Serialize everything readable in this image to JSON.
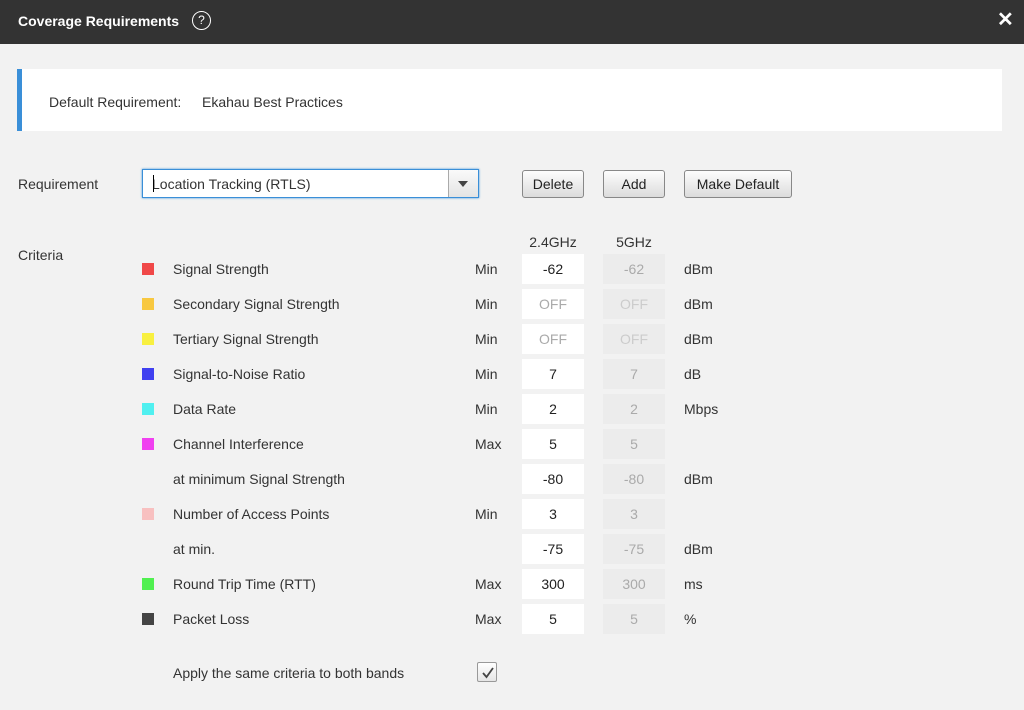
{
  "window": {
    "title": "Coverage Requirements",
    "help_icon": "question-circle-icon",
    "close_icon": "close-icon"
  },
  "banner": {
    "label": "Default Requirement:",
    "value": "Ekahau Best Practices",
    "accent": "#3a8fd8"
  },
  "requirement": {
    "label": "Requirement",
    "selected": "Location Tracking (RTLS)",
    "buttons": {
      "delete": "Delete",
      "add": "Add",
      "make_default": "Make Default"
    }
  },
  "criteria": {
    "label": "Criteria",
    "col_24": "2.4GHz",
    "col_5": "5GHz",
    "rows": [
      {
        "name": "Signal Strength",
        "minmax": "Min",
        "v24": "-62",
        "v5": "-62",
        "unit": "dBm",
        "color": "#f04848",
        "off": false
      },
      {
        "name": "Secondary Signal Strength",
        "minmax": "Min",
        "v24": "OFF",
        "v5": "OFF",
        "unit": "dBm",
        "color": "#f8c840",
        "off": true
      },
      {
        "name": "Tertiary Signal Strength",
        "minmax": "Min",
        "v24": "OFF",
        "v5": "OFF",
        "unit": "dBm",
        "color": "#f8f040",
        "off": true
      },
      {
        "name": "Signal-to-Noise Ratio",
        "minmax": "Min",
        "v24": "7",
        "v5": "7",
        "unit": "dB",
        "color": "#4040f0",
        "off": false
      },
      {
        "name": "Data Rate",
        "minmax": "Min",
        "v24": "2",
        "v5": "2",
        "unit": "Mbps",
        "color": "#50f0f0",
        "off": false
      },
      {
        "name": "Channel Interference",
        "minmax": "Max",
        "v24": "5",
        "v5": "5",
        "unit": "",
        "color": "#f040f0",
        "off": false
      },
      {
        "name": "at minimum Signal Strength",
        "minmax": "",
        "v24": "-80",
        "v5": "-80",
        "unit": "dBm",
        "color": "",
        "off": false
      },
      {
        "name": "Number of Access Points",
        "minmax": "Min",
        "v24": "3",
        "v5": "3",
        "unit": "",
        "color": "#f8c0c0",
        "off": false
      },
      {
        "name": "at min.",
        "minmax": "",
        "v24": "-75",
        "v5": "-75",
        "unit": "dBm",
        "color": "",
        "off": false
      },
      {
        "name": "Round Trip Time (RTT)",
        "minmax": "Max",
        "v24": "300",
        "v5": "300",
        "unit": "ms",
        "color": "#50f050",
        "off": false
      },
      {
        "name": "Packet Loss",
        "minmax": "Max",
        "v24": "5",
        "v5": "5",
        "unit": "%",
        "color": "#444444",
        "off": false
      }
    ]
  },
  "apply_same": {
    "label": "Apply the same criteria to both bands",
    "checked": true
  }
}
